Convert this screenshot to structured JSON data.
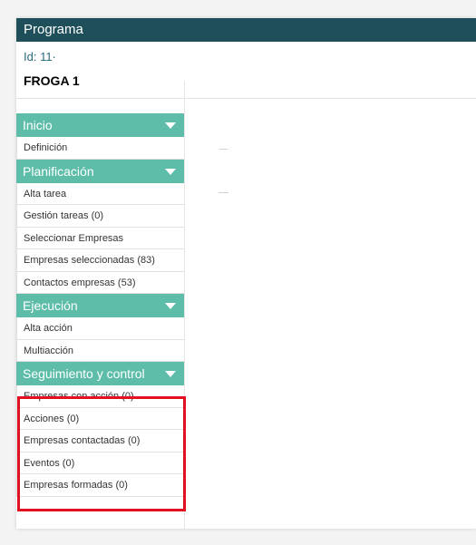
{
  "window": {
    "title": "Programa"
  },
  "program": {
    "id_label": "Id: 11·",
    "name": "FROGA 1"
  },
  "colors": {
    "titlebar": "#1e4f5a",
    "section_header": "#5dbda9",
    "highlight_border": "#e3101f"
  },
  "sidebar": {
    "sections": [
      {
        "label": "Inicio",
        "items": [
          "Definición"
        ]
      },
      {
        "label": "Planificación",
        "items": [
          "Alta tarea",
          "Gestión tareas (0)",
          "Seleccionar Empresas",
          "Empresas seleccionadas (83)",
          "Contactos empresas (53)"
        ]
      },
      {
        "label": "Ejecución",
        "items": [
          "Alta acción",
          "Multiacción"
        ]
      },
      {
        "label": "Seguimiento y control",
        "items": [
          "Empresas con acción (0)",
          "Acciones (0)",
          "Empresas contactadas (0)",
          "Eventos (0)",
          "Empresas formadas (0)"
        ]
      }
    ]
  }
}
